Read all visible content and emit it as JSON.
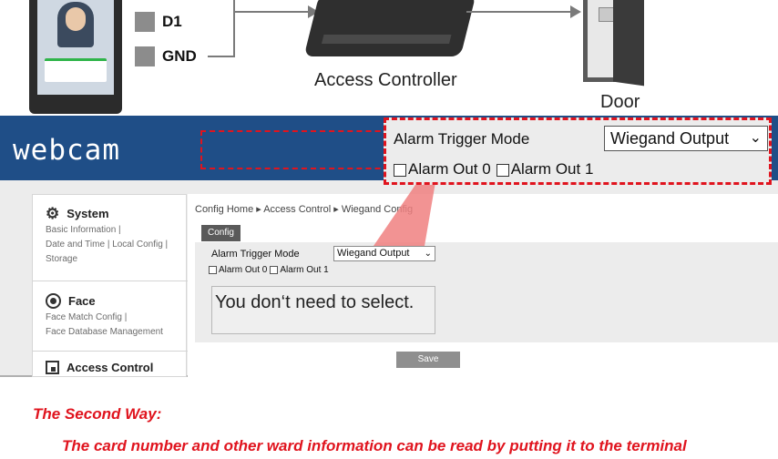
{
  "diagram": {
    "terminal_d1": "D1",
    "terminal_gnd": "GND",
    "controller_caption": "Access Controller",
    "door_caption": "Door"
  },
  "app": {
    "logo": "webcam"
  },
  "sidebar": {
    "sections": [
      {
        "title": "System",
        "icon": "gear-icon",
        "links": [
          "Basic Information |",
          "Date and Time | Local Config |",
          "Storage"
        ]
      },
      {
        "title": "Face",
        "icon": "face-icon",
        "links": [
          "Face Match Config |",
          "Face Database Management"
        ]
      },
      {
        "title": "Access Control",
        "icon": "access-control-icon",
        "links": []
      }
    ]
  },
  "main": {
    "breadcrumb": "Config Home ▸ Access Control ▸ Wiegand Config",
    "tab": "Config",
    "alarm_trigger_label": "Alarm Trigger Mode",
    "alarm_trigger_value": "Wiegand Output",
    "alarm_out_0": "Alarm Out 0",
    "alarm_out_1": "Alarm Out 1",
    "note": "You don‘t need to select.",
    "save_label": "Save"
  },
  "callout": {
    "alarm_trigger_label": "Alarm Trigger Mode",
    "alarm_trigger_value": "Wiegand Output",
    "alarm_out_0": "Alarm Out 0",
    "alarm_out_1": "Alarm Out 1"
  },
  "footer": {
    "heading": "The Second Way:",
    "line": "The card number and other ward information can be read by putting it to the terminal"
  },
  "colors": {
    "accent_red": "#e0141e",
    "header_blue": "#1f4e87"
  }
}
